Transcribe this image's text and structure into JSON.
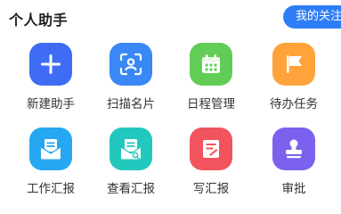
{
  "header": {
    "title": "个人助手",
    "follow_label": "我的关注"
  },
  "tiles": [
    {
      "label": "新建助手",
      "icon": "plus-icon",
      "color": "#3e6cf4"
    },
    {
      "label": "扫描名片",
      "icon": "scan-card-icon",
      "color": "#3a87f7"
    },
    {
      "label": "日程管理",
      "icon": "calendar-icon",
      "color": "#62cd56"
    },
    {
      "label": "待办任务",
      "icon": "flag-icon",
      "color": "#ffa33a"
    },
    {
      "label": "工作汇报",
      "icon": "mail-doc-icon",
      "color": "#27a7f2"
    },
    {
      "label": "查看汇报",
      "icon": "mail-search-icon",
      "color": "#22c8be"
    },
    {
      "label": "写汇报",
      "icon": "edit-doc-icon",
      "color": "#f2545e"
    },
    {
      "label": "审批",
      "icon": "stamp-icon",
      "color": "#7b61ee"
    }
  ]
}
